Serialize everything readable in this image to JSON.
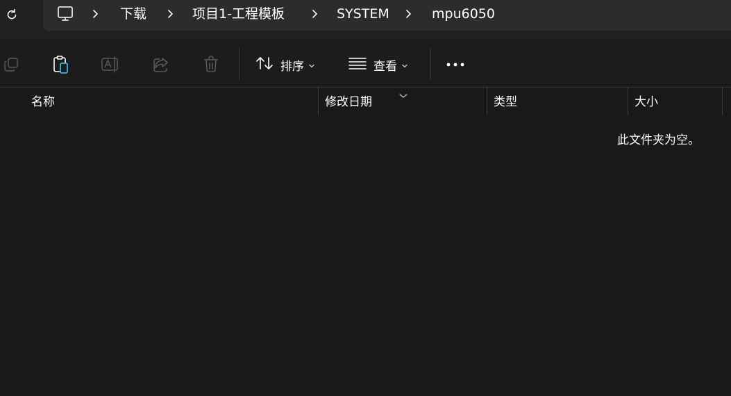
{
  "address_bar": {
    "breadcrumbs": [
      "下载",
      "项目1-工程模板",
      "SYSTEM",
      "mpu6050"
    ]
  },
  "toolbar": {
    "sort_label": "排序",
    "view_label": "查看"
  },
  "columns": {
    "name": "名称",
    "modified": "修改日期",
    "type": "类型",
    "size": "大小"
  },
  "content": {
    "empty_message": "此文件夹为空。"
  },
  "icons": {
    "refresh": "refresh-icon",
    "this_pc": "monitor-icon",
    "copy": "copy-icon",
    "paste": "paste-icon",
    "rename": "rename-icon",
    "share": "share-icon",
    "delete": "trash-icon",
    "sort": "sort-icon",
    "view": "view-list-icon",
    "more": "more-icon"
  },
  "colors": {
    "background": "#191919",
    "address_bar": "#2c2c2c",
    "accent_blue": "#4cc2ff"
  }
}
